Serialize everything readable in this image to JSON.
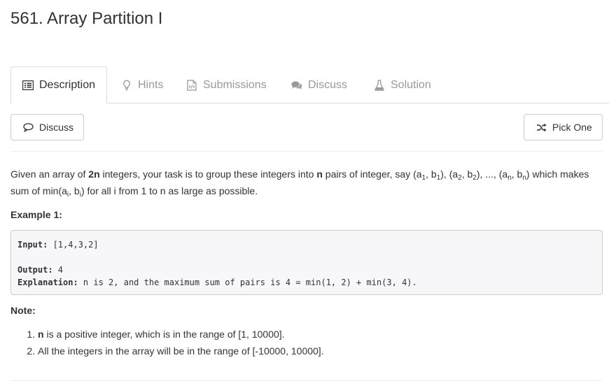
{
  "page": {
    "title": "561. Array Partition I"
  },
  "tabs": [
    {
      "label": "Description",
      "icon": "list-alt-icon"
    },
    {
      "label": "Hints",
      "icon": "lightbulb-icon"
    },
    {
      "label": "Submissions",
      "icon": "code-file-icon"
    },
    {
      "label": "Discuss",
      "icon": "comments-icon"
    },
    {
      "label": "Solution",
      "icon": "flask-icon"
    }
  ],
  "toolbar": {
    "discuss_label": "Discuss",
    "pick_one_label": "Pick One"
  },
  "problem": {
    "p1": "Given an array of ",
    "p1b": "2n",
    "p2": " integers, your task is to group these integers into ",
    "p2b": "n",
    "p3": " pairs of integer, say (a",
    "s1": "1",
    "p4": ", b",
    "s2": "1",
    "p5": "), (a",
    "s3": "2",
    "p6": ", b",
    "s4": "2",
    "p7": "), ..., (a",
    "s5": "n",
    "p8": ", b",
    "s6": "n",
    "p9": ") which makes sum of min(a",
    "s7": "i",
    "p10": ", b",
    "s8": "i",
    "p11": ") for all i from 1 to n as large as possible."
  },
  "example": {
    "label": "Example 1:",
    "input_label": "Input:",
    "input_value": " [1,4,3,2]",
    "output_label": "Output:",
    "output_value": " 4",
    "explanation_label": "Explanation:",
    "explanation_value": " n is 2, and the maximum sum of pairs is 4 = min(1, 2) + min(3, 4)."
  },
  "note": {
    "label": "Note:",
    "item1_bold": "n",
    "item1_rest": " is a positive integer, which is in the range of [1, 10000].",
    "item2": "All the integers in the array will be in the range of [-10000, 10000]."
  }
}
